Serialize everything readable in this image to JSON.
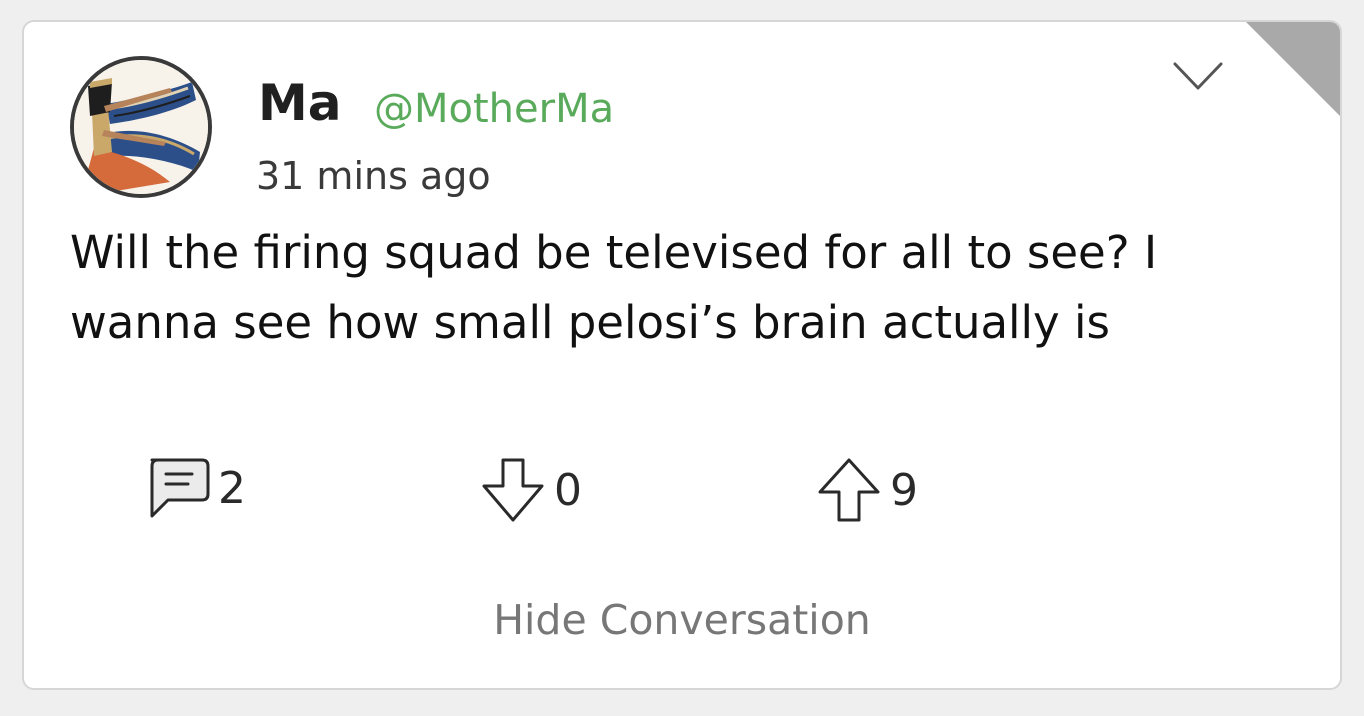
{
  "post": {
    "author_name": "Ma",
    "author_handle": "@MotherMa",
    "timestamp": "31 mins ago",
    "text": "Will the firing squad be televised for all to see? I wanna see how small pelosi’s brain actually is",
    "avatar_icon": "egyptian-winged-goddess-avatar",
    "menu_icon": "chevron-down-icon"
  },
  "actions": {
    "comments": {
      "icon": "comment-icon",
      "count": "2"
    },
    "downvotes": {
      "icon": "arrow-down-icon",
      "count": "0"
    },
    "upvotes": {
      "icon": "arrow-up-icon",
      "count": "9"
    }
  },
  "footer": {
    "hide_label": "Hide Conversation"
  },
  "colors": {
    "handle": "#5aaa5c",
    "corner_fold": "#a9a9a9",
    "card_border": "#d6d6d6"
  }
}
